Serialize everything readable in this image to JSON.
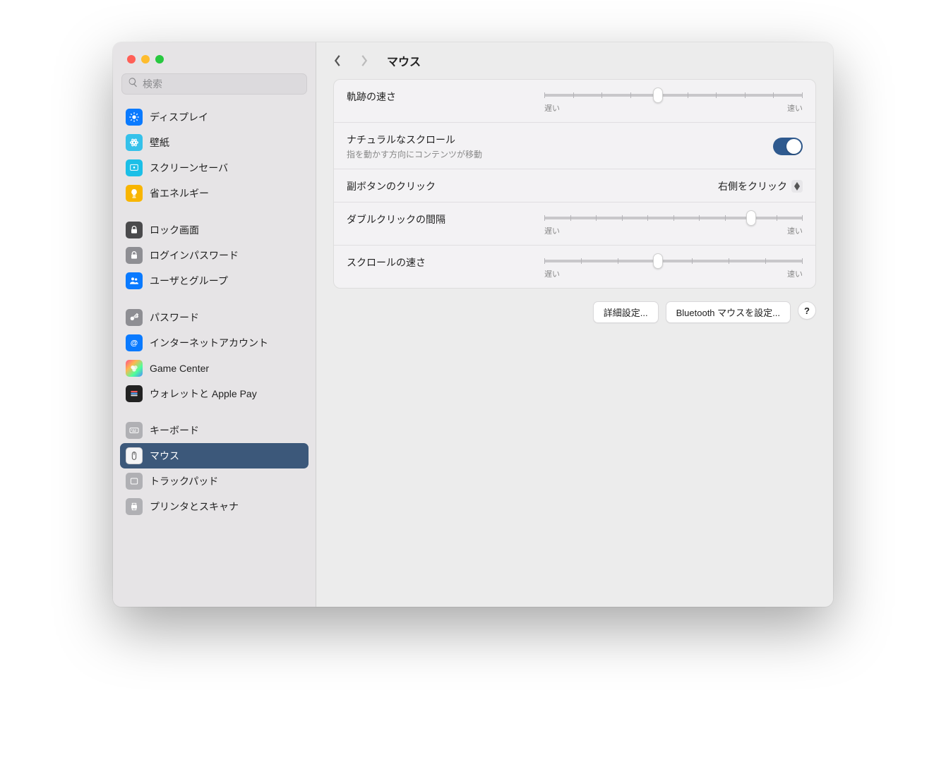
{
  "search": {
    "placeholder": "検索"
  },
  "sidebar": {
    "groups": [
      [
        {
          "key": "display",
          "label": "ディスプレイ"
        },
        {
          "key": "wallpaper",
          "label": "壁紙"
        },
        {
          "key": "screensaver",
          "label": "スクリーンセーバ"
        },
        {
          "key": "energy",
          "label": "省エネルギー"
        }
      ],
      [
        {
          "key": "lockscreen",
          "label": "ロック画面"
        },
        {
          "key": "loginpw",
          "label": "ログインパスワード"
        },
        {
          "key": "users",
          "label": "ユーザとグループ"
        }
      ],
      [
        {
          "key": "passwords",
          "label": "パスワード"
        },
        {
          "key": "internetacc",
          "label": "インターネットアカウント"
        },
        {
          "key": "gamecenter",
          "label": "Game Center"
        },
        {
          "key": "wallet",
          "label": "ウォレットと Apple Pay"
        }
      ],
      [
        {
          "key": "keyboard",
          "label": "キーボード"
        },
        {
          "key": "mouse",
          "label": "マウス",
          "selected": true
        },
        {
          "key": "trackpad",
          "label": "トラックパッド"
        },
        {
          "key": "printers",
          "label": "プリンタとスキャナ"
        }
      ]
    ]
  },
  "header": {
    "title": "マウス"
  },
  "settings": {
    "tracking": {
      "label": "軌跡の速さ",
      "slow": "遅い",
      "fast": "速い",
      "value_percent": 44
    },
    "natural_scroll": {
      "label": "ナチュラルなスクロール",
      "sublabel": "指を動かす方向にコンテンツが移動",
      "enabled": true
    },
    "secondary_click": {
      "label": "副ボタンのクリック",
      "value": "右側をクリック"
    },
    "double_click": {
      "label": "ダブルクリックの間隔",
      "slow": "遅い",
      "fast": "速い",
      "value_percent": 80
    },
    "scroll_speed": {
      "label": "スクロールの速さ",
      "slow": "遅い",
      "fast": "速い",
      "value_percent": 44
    }
  },
  "footer": {
    "advanced": "詳細設定...",
    "bluetooth": "Bluetooth マウスを設定...",
    "help": "?"
  }
}
